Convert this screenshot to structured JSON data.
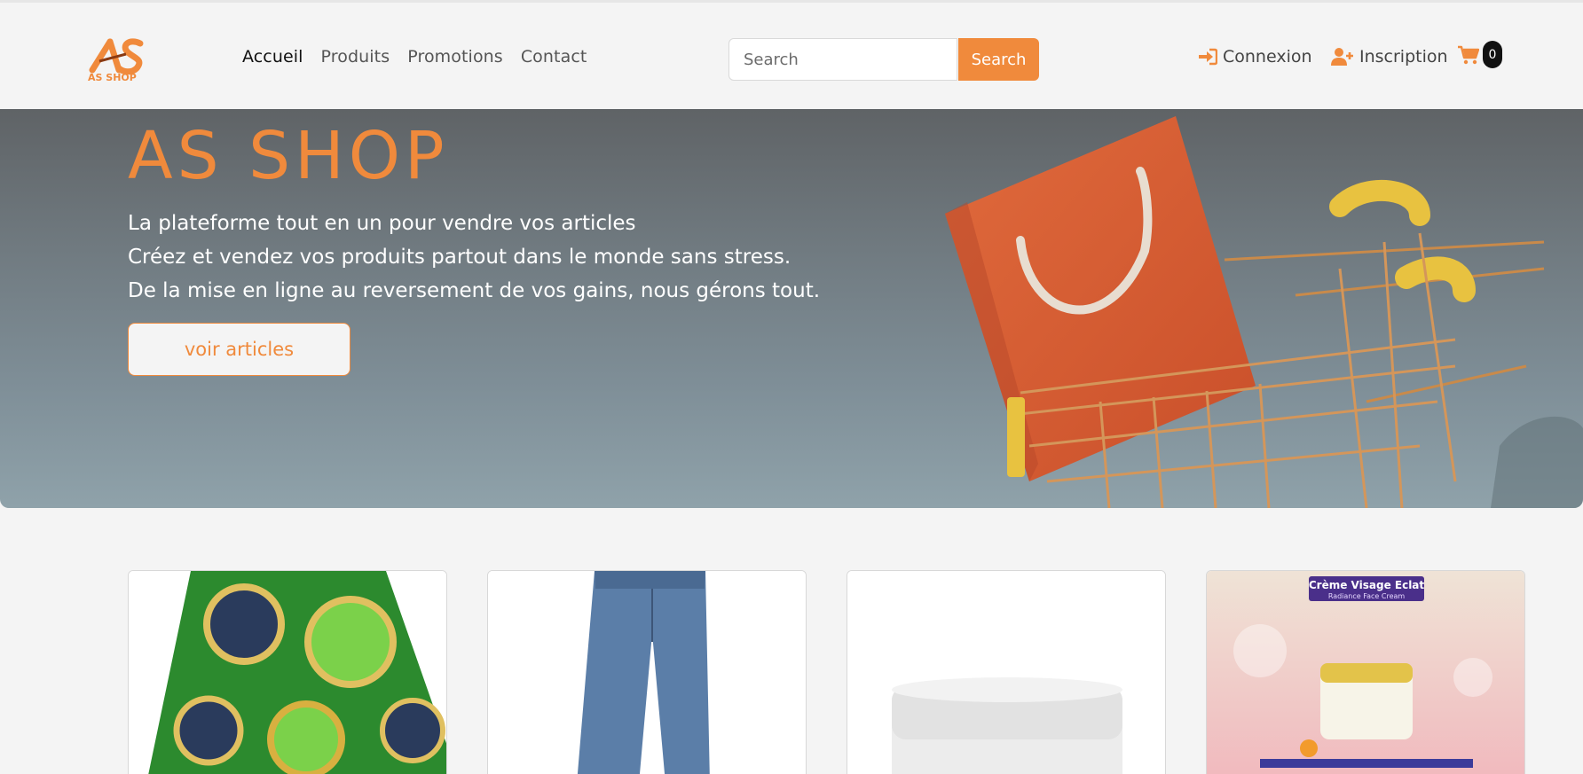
{
  "brand": {
    "logo_text": "AS SHOP"
  },
  "nav": {
    "links": [
      {
        "label": "Accueil",
        "active": true
      },
      {
        "label": "Produits",
        "active": false
      },
      {
        "label": "Promotions",
        "active": false
      },
      {
        "label": "Contact",
        "active": false
      }
    ]
  },
  "search": {
    "placeholder": "Search",
    "value": "",
    "button_label": "Search"
  },
  "auth": {
    "login_label": "Connexion",
    "signup_label": "Inscription"
  },
  "cart": {
    "count": "0",
    "icon": "shopping-cart-icon"
  },
  "hero": {
    "title": "AS SHOP",
    "lines": [
      "La plateforme tout en un pour vendre vos articles",
      "Créez et vendez vos produits partout dans le monde sans stress.",
      "De la mise en ligne au reversement de vos gains, nous gérons tout."
    ],
    "button_label": "voir articles"
  },
  "products": [
    {
      "name": "wax-fabric"
    },
    {
      "name": "jeans"
    },
    {
      "name": "cream-jar"
    },
    {
      "name": "face-cream",
      "caption_title": "Crème Visage Eclat",
      "caption_subtitle": "Radiance Face Cream"
    }
  ],
  "colors": {
    "accent": "#f08a3c",
    "background": "#f4f4f4",
    "text": "#444444"
  }
}
